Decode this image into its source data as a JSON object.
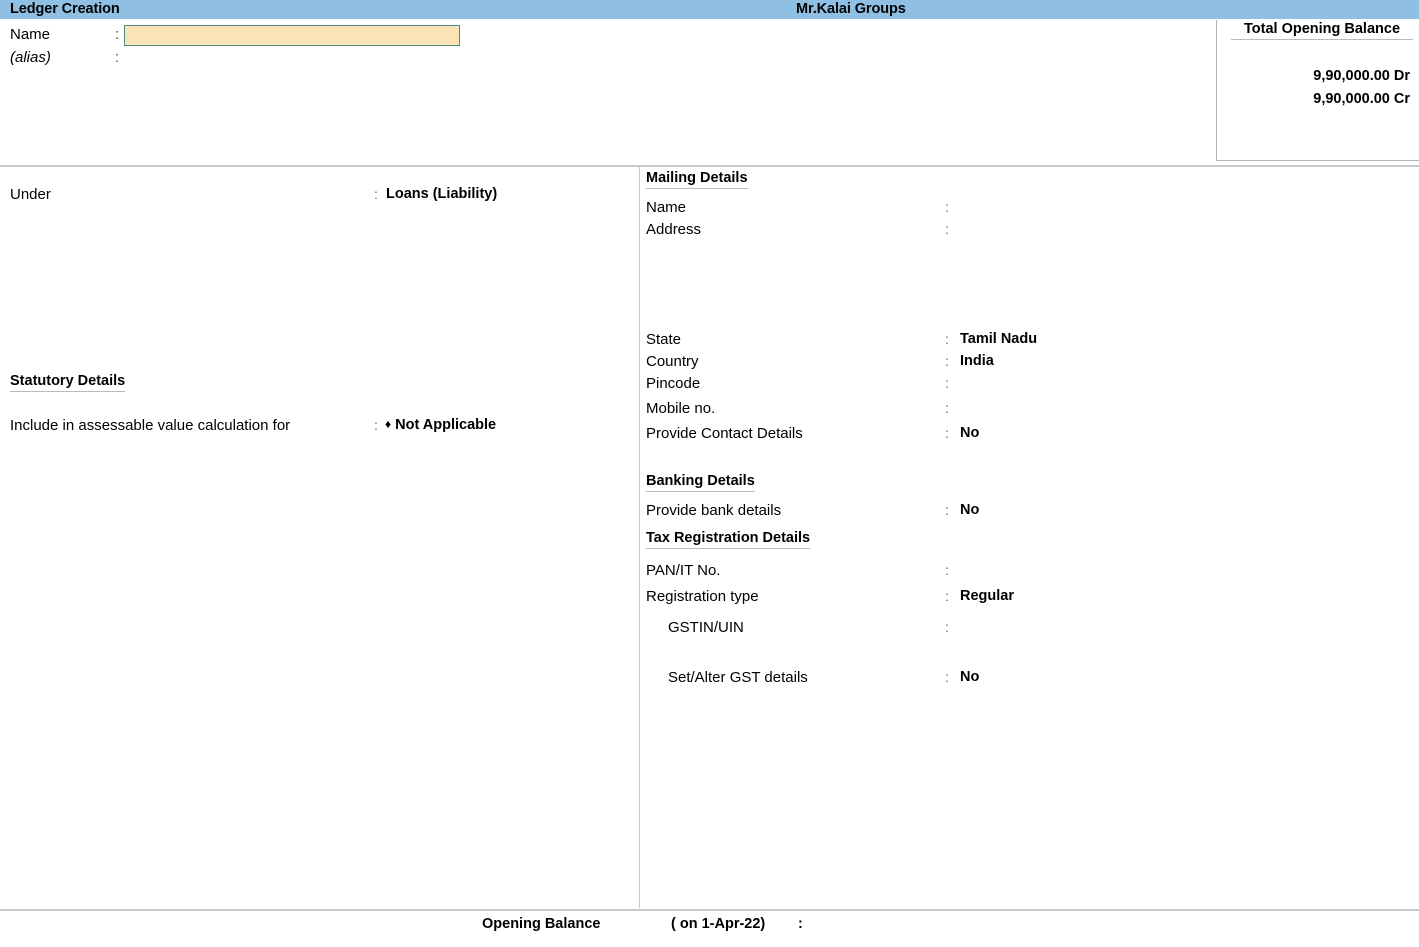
{
  "title_bar": {
    "screen_title": "Ledger Creation",
    "company_name": "Mr.Kalai Groups"
  },
  "identity": {
    "name_label": "Name",
    "name_value": "",
    "name_placeholder": "",
    "alias_label": "(alias)",
    "alias_value": "",
    "colon": ":"
  },
  "total_opening_balance": {
    "heading": "Total Opening Balance",
    "debit": "9,90,000.00 Dr",
    "credit": "9,90,000.00 Cr"
  },
  "left_pane": {
    "under": {
      "label": "Under",
      "colon": ":",
      "value": "Loans (Liability)"
    },
    "statutory_heading": "Statutory Details",
    "assessable": {
      "label": "Include in assessable value calculation for",
      "colon": ":",
      "bullet": "♦",
      "value": "Not Applicable"
    }
  },
  "right_pane": {
    "mailing_heading": "Mailing Details",
    "mailing_fields": [
      {
        "label": "Name",
        "colon": ":",
        "value": ""
      },
      {
        "label": "Address",
        "colon": ":",
        "value": ""
      },
      {
        "label": "State",
        "colon": ":",
        "value": "Tamil Nadu"
      },
      {
        "label": "Country",
        "colon": ":",
        "value": "India"
      },
      {
        "label": "Pincode",
        "colon": ":",
        "value": ""
      },
      {
        "label": "Mobile no.",
        "colon": ":",
        "value": ""
      },
      {
        "label": "Provide Contact Details",
        "colon": ":",
        "value": "No"
      }
    ],
    "banking_heading": "Banking Details",
    "banking_fields": [
      {
        "label": "Provide bank details",
        "colon": ":",
        "value": "No"
      }
    ],
    "tax_heading": "Tax Registration Details",
    "tax_fields": [
      {
        "label": "PAN/IT No.",
        "colon": ":",
        "value": ""
      },
      {
        "label": "Registration type",
        "colon": ":",
        "value": "Regular"
      },
      {
        "label": "GSTIN/UIN",
        "colon": ":",
        "value": ""
      },
      {
        "label": "Set/Alter GST details",
        "colon": ":",
        "value": "No"
      }
    ]
  },
  "bottom_bar": {
    "opening_balance_label": "Opening Balance",
    "as_on": "( on 1-Apr-22)",
    "colon": ":",
    "value": ""
  },
  "colors": {
    "title_bar_bg": "#8fbfe2",
    "input_bg": "#fae3b4",
    "input_border": "#4f8d8b",
    "divider": "#c9c9c9",
    "text": "#000000"
  }
}
